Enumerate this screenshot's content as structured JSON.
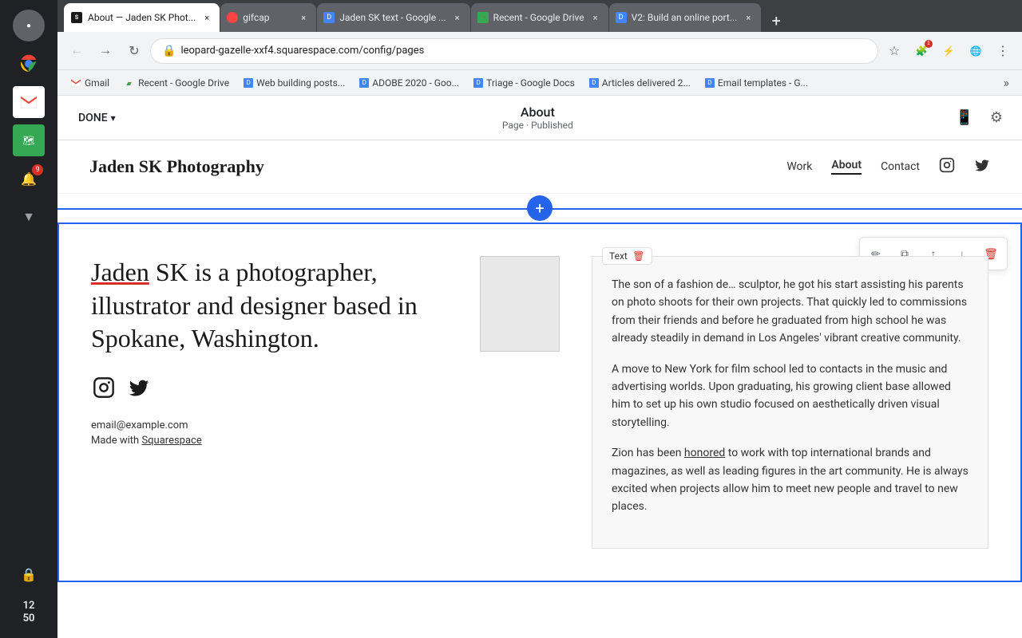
{
  "os": {
    "time": "12",
    "time2": "50"
  },
  "tabs": [
    {
      "id": "tab-about",
      "favicon_type": "sq",
      "title": "About — Jaden SK Phot...",
      "active": true,
      "closable": true
    },
    {
      "id": "tab-gifcap",
      "favicon_type": "gifcap",
      "title": "gifcap",
      "active": false,
      "closable": true
    },
    {
      "id": "tab-docs",
      "favicon_type": "docs",
      "title": "Jaden SK text - Google ...",
      "active": false,
      "closable": true
    },
    {
      "id": "tab-drive",
      "favicon_type": "drive",
      "title": "Recent - Google Drive",
      "active": false,
      "closable": true
    },
    {
      "id": "tab-v2",
      "favicon_type": "docs",
      "title": "V2: Build an online port...",
      "active": false,
      "closable": true
    }
  ],
  "addressbar": {
    "url": "leopard-gazelle-xxf4.squarespace.com/config/pages"
  },
  "bookmarks": [
    {
      "id": "bm-gmail",
      "label": "Gmail",
      "favicon": "gmail"
    },
    {
      "id": "bm-drive",
      "label": "Recent - Google Drive",
      "favicon": "drive"
    },
    {
      "id": "bm-webbuilding",
      "label": "Web building posts...",
      "favicon": "docs"
    },
    {
      "id": "bm-adobe",
      "label": "ADOBE 2020 - Goo...",
      "favicon": "docs"
    },
    {
      "id": "bm-triage",
      "label": "Triage - Google Docs",
      "favicon": "docs"
    },
    {
      "id": "bm-articles",
      "label": "Articles delivered 2...",
      "favicon": "docs"
    },
    {
      "id": "bm-email-templates",
      "label": "Email templates - G...",
      "favicon": "docs"
    }
  ],
  "cms": {
    "done_label": "DONE",
    "page_title": "About",
    "page_status": "Page · Published"
  },
  "site": {
    "logo": "Jaden SK Photography",
    "nav": {
      "work": "Work",
      "about": "About",
      "contact": "Contact"
    },
    "bio_heading_name": "Jaden",
    "bio_heading_rest": " SK is a photographer, illustrator and designer based in Spokane, Washington.",
    "bio_para1": "The son of a fashion de… sculptor, he got his start assisting his parents on photo shoots for their own projects. That quickly led to commissions from their friends and before he graduated from high school he was already steadily in demand in Los Angeles' vibrant creative community.",
    "bio_para2": "A move to New York for film school led to contacts in the music and advertising worlds. Upon graduating, his growing client base allowed him to set up his own studio focused on aesthetically driven visual storytelling.",
    "bio_para3": "Zion has been honored to work with top international brands and magazines, as well as leading figures in the art community. He is always excited when projects allow him to meet new people and travel to new places.",
    "honored_text": "honored",
    "contact_email": "email@example.com",
    "made_with": "Made with ",
    "squarespace": "Squarespace",
    "text_label": "Text"
  },
  "toolbar": {
    "edit_icon": "✏",
    "copy_icon": "⧉",
    "up_icon": "↑",
    "down_icon": "↓",
    "delete_icon": "🗑"
  }
}
